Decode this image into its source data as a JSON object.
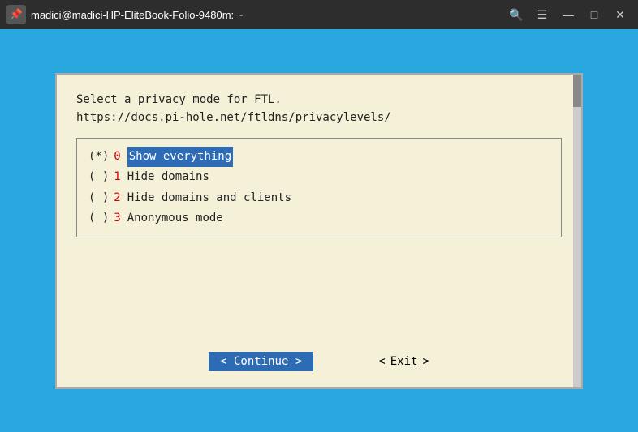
{
  "titlebar": {
    "title": "madici@madici-HP-EliteBook-Folio-9480m: ~",
    "icon": "📌"
  },
  "buttons": {
    "search": "🔍",
    "menu": "☰",
    "minimize": "—",
    "maximize": "□",
    "close": "✕"
  },
  "dialog": {
    "line1": "Select a privacy mode for FTL.",
    "line2": "https://docs.pi-hole.net/ftldns/privacylevels/",
    "options": [
      {
        "marker": "(*)",
        "number": "0",
        "label": "Show everything",
        "selected": true
      },
      {
        "marker": "( )",
        "number": "1",
        "label": "Hide domains",
        "selected": false
      },
      {
        "marker": "( )",
        "number": "2",
        "label": "Hide domains and clients",
        "selected": false
      },
      {
        "marker": "( )",
        "number": "3",
        "label": "Anonymous mode",
        "selected": false
      }
    ],
    "continue_btn": "< Continue >",
    "exit_left": "<",
    "exit_label": "Exit",
    "exit_right": ">"
  }
}
